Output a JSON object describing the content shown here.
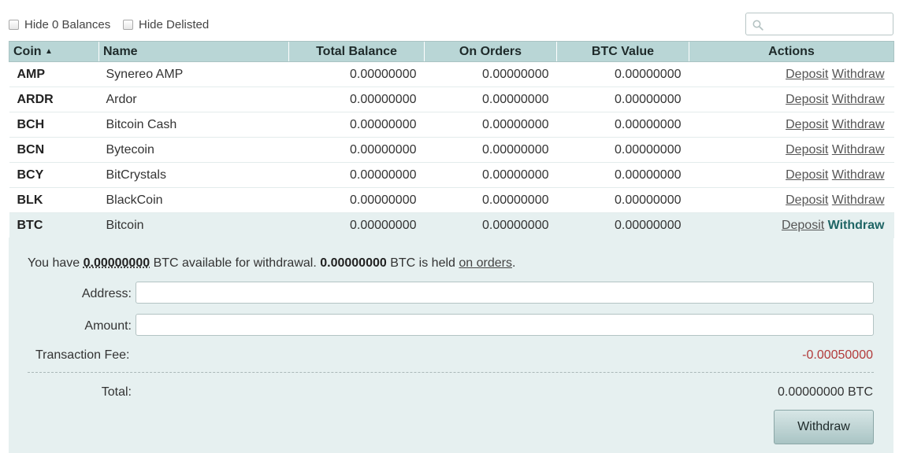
{
  "filters": {
    "hide_zero_label": "Hide 0 Balances",
    "hide_delisted_label": "Hide Delisted",
    "search_placeholder": ""
  },
  "table": {
    "columns": {
      "coin": "Coin",
      "name": "Name",
      "total": "Total Balance",
      "on_orders": "On Orders",
      "btc_value": "BTC Value",
      "actions": "Actions"
    },
    "sort_indicator": "▲",
    "deposit_label": "Deposit",
    "withdraw_label": "Withdraw",
    "rows": [
      {
        "coin": "AMP",
        "name": "Synereo AMP",
        "total": "0.00000000",
        "on_orders": "0.00000000",
        "btc_value": "0.00000000"
      },
      {
        "coin": "ARDR",
        "name": "Ardor",
        "total": "0.00000000",
        "on_orders": "0.00000000",
        "btc_value": "0.00000000"
      },
      {
        "coin": "BCH",
        "name": "Bitcoin Cash",
        "total": "0.00000000",
        "on_orders": "0.00000000",
        "btc_value": "0.00000000"
      },
      {
        "coin": "BCN",
        "name": "Bytecoin",
        "total": "0.00000000",
        "on_orders": "0.00000000",
        "btc_value": "0.00000000"
      },
      {
        "coin": "BCY",
        "name": "BitCrystals",
        "total": "0.00000000",
        "on_orders": "0.00000000",
        "btc_value": "0.00000000"
      },
      {
        "coin": "BLK",
        "name": "BlackCoin",
        "total": "0.00000000",
        "on_orders": "0.00000000",
        "btc_value": "0.00000000"
      },
      {
        "coin": "BTC",
        "name": "Bitcoin",
        "total": "0.00000000",
        "on_orders": "0.00000000",
        "btc_value": "0.00000000"
      }
    ]
  },
  "withdraw": {
    "info_prefix": "You have",
    "available": "0.00000000",
    "info_mid": "BTC available for withdrawal.",
    "held": "0.00000000",
    "info_mid2": "BTC is held",
    "on_orders_link": "on orders",
    "info_suffix": ".",
    "address_label": "Address:",
    "address_value": "",
    "amount_label": "Amount:",
    "amount_value": "",
    "fee_label": "Transaction Fee:",
    "fee_value": "-0.00050000",
    "total_label": "Total:",
    "total_value": "0.00000000 BTC",
    "button_label": "Withdraw"
  },
  "colors": {
    "header_bg": "#b9d6d6",
    "panel_bg": "#e6f0f0",
    "fee_red": "#b23a3a",
    "active_link": "#1f6565"
  }
}
